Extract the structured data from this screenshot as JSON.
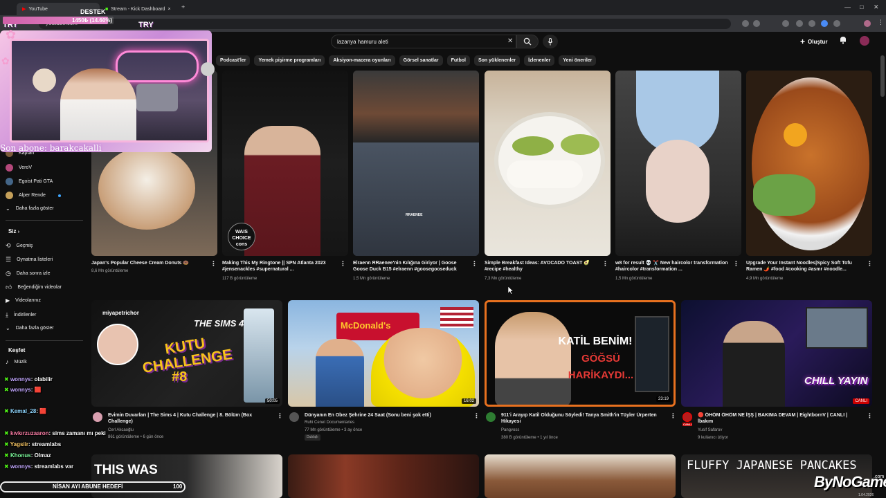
{
  "browser": {
    "tabs": [
      {
        "label": "YouTube",
        "active": true
      },
      {
        "label": "Stream - Kick Dashboard",
        "active": false
      }
    ],
    "url": "youtube.com"
  },
  "youtube": {
    "search_query": "lazanya hamuru aleti",
    "create_label": "Oluştur",
    "chips": [
      "Podcast'ler",
      "Yemek pişirme programları",
      "Aksiyon-macera oyunları",
      "Görsel sanatlar",
      "Futbol",
      "Son yüklenenler",
      "İzlenenler",
      "Yeni öneriler"
    ]
  },
  "sidebar": {
    "subscriptions": [
      {
        "label": "Kaptan",
        "color": "#7a5a3a"
      },
      {
        "label": "VeroV",
        "color": "#b4487a"
      },
      {
        "label": "Egoist Pati GTA",
        "color": "#446688"
      },
      {
        "label": "Alper Rende",
        "color": "#c5a05a"
      }
    ],
    "more_subs": "Daha fazla göster",
    "you_header": "Siz",
    "you_items": [
      "Geçmiş",
      "Oynatma listeleri",
      "Daha sonra izle",
      "Beğendiğim videolar",
      "Videolarınız",
      "İndirilenler",
      "Daha fazla göster"
    ],
    "explore_header": "Keşfet",
    "explore_items": [
      "Müzik"
    ]
  },
  "videos_row1": [
    {
      "title": "Japan's Popular Cheese Cream Donuts 🍩",
      "meta": "8,6 Mn görüntüleme",
      "thumb_colors": [
        "#3a3a3a",
        "#e9e4dc",
        "#c8a27a"
      ]
    },
    {
      "title": "Making This My Ringtone || SPN Atlanta 2023 #jensenackles #supernatural ...",
      "meta": "117 B görüntüleme",
      "badge": "WAIS CHOICE cons",
      "thumb_colors": [
        "#1b1b1b",
        "#6e1d23",
        "#2a2a2a"
      ]
    },
    {
      "title": "Elraenn RRaenee'nin Kılığına Giriyor | Goose Goose Duck B15 #elraenn #goosegooseduck",
      "meta": "1,5 Mn görüntüleme",
      "game_label": "RRAENEE",
      "thumb_colors": [
        "#2a2a2a",
        "#a06a4a",
        "#4a4f5a"
      ]
    },
    {
      "title": "Simple Breakfast Ideas: AVOCADO TOAST 🥑 #recipe #healthy",
      "meta": "7,3 Mn görüntüleme",
      "thumb_colors": [
        "#cfc3b0",
        "#f5f2ea",
        "#8fb046"
      ]
    },
    {
      "title": "w8 for result 💀 ✂️ New haircolor transformation #haircolor #transformation ...",
      "meta": "1,5 Mn görüntüleme",
      "thumb_colors": [
        "#2a2a2a",
        "#a9c8e6",
        "#e8d2c8"
      ]
    },
    {
      "title": "Upgrade Your Instant Noodles|Spicy Soft Tofu Ramen 🌶️ #food #cooking #asmr #noodle...",
      "meta": "4,9 Mn görüntüleme",
      "thumb_colors": [
        "#3b2a1a",
        "#c9722b",
        "#6ba246"
      ]
    }
  ],
  "videos_row2": [
    {
      "title": "Evimin Duvarları | The Sims 4 | Kutu Challenge | 8. Bölüm (Box Challenge)",
      "channel": "Cerl Akcaoğlu",
      "meta": "861 görüntüleme • 6 gün önce",
      "duration": "50:05",
      "overlay_top": "miyapetrichor",
      "overlay_main": "KUTU CHALLENGE",
      "overlay_num": "#8",
      "overlay_logo": "THE SIMS 4",
      "avatar_color": "#d9a0b0"
    },
    {
      "title": "Dünyanın En Obez Şehrine 24 Saat (Sonu beni şok etti)",
      "channel": "Ruhi Cenet Documentaries",
      "meta": "77 Mn görüntüleme • 3 ay önce",
      "extra": "Dublajlı",
      "duration": "16:02",
      "overlay_main": "McDonald's",
      "avatar_color": "#555555"
    },
    {
      "title": "911'i Arayıp Katil Olduğunu Söyledi! Tanya Smith'in Tüyler Ürperten Hikayesi",
      "channel": "Pangvoss",
      "meta": "380 B görüntüleme • 1 yıl önce",
      "duration": "23:19",
      "overlay_main": "KATİL BENİM!",
      "overlay_sub": "GÖĞSÜ HARİKAYDI...",
      "avatar_color": "#2e7d32"
    },
    {
      "title": "🔴 ÖHÖM ÖHÖM NE İŞŞ | BAKIMA DEVAM | EightbornV | CANLI | İbakım",
      "channel": "Yusif Safarov",
      "meta": "9 kullanıcı izliyor",
      "duration": "CANLI",
      "live_label": "CANLI",
      "overlay_main": "CHILL YAYIN",
      "avatar_color": "#b71c1c"
    }
  ],
  "videos_row3": [
    {
      "overlay": "THIS WAS"
    },
    {
      "overlay": ""
    },
    {
      "overlay": ""
    },
    {
      "overlay": "FLUFFY JAPANESE PANCAKES"
    }
  ],
  "stream_overlay": {
    "donation_label": "DESTEK",
    "donation_progress": "1450₺ (14.60%)",
    "donation_fraction": 0.146,
    "cam_caption": "Son abone: barakcakalli",
    "try_left": "TRY",
    "try_right": "TRY",
    "sub_goal": "NİSAN AYI ABUNE HEDEFİ",
    "sub_goal_value": "100",
    "watermark": "ByNoGame",
    "watermark_small": ".com",
    "watermark_date": "1.04.2026"
  },
  "chat": [
    {
      "user": "wonnys",
      "msg": ": olabilir"
    },
    {
      "user": "wonnys",
      "msg": ": 🟥"
    },
    {
      "user": "Kemal_28",
      "msg": ": 🟥"
    },
    {
      "user": "kıvkırzuzaaron",
      "msg": ": sims zamanı mı peki"
    },
    {
      "user": "Yagsiir",
      "msg": ": streamlabs"
    },
    {
      "user": "Khonus",
      "msg": ": Olmaz"
    },
    {
      "user": "wonnys",
      "msg": ": streamlabs var"
    }
  ]
}
